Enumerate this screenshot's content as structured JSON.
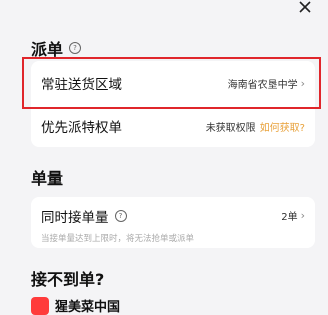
{
  "sections": {
    "dispatch": {
      "title": "派单"
    },
    "orders": {
      "title": "单量"
    },
    "no_orders": {
      "title": "接不到单?"
    }
  },
  "dispatch_rows": {
    "area": {
      "label": "常驻送货区域",
      "value": "海南省农垦中学"
    },
    "priority": {
      "label": "优先派特权单",
      "value": "未获取权限",
      "link": "如何获取?"
    }
  },
  "orders_row": {
    "label": "同时接单量",
    "value": "2单",
    "note": "当接单量达到上限时，将无法抢单或派单"
  },
  "brand": {
    "text": "猩美菜中国"
  },
  "icons": {
    "close": "close-icon",
    "help": "help-icon",
    "chevron": "chevron-right-icon"
  },
  "colors": {
    "highlight": "#e0262b",
    "link": "#e8a13a",
    "background": "#f4f4f6"
  }
}
